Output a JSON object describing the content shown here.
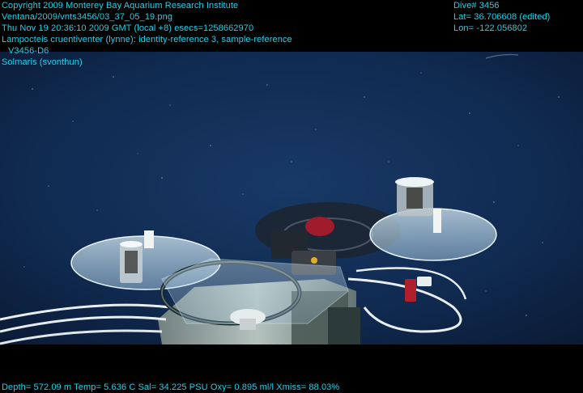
{
  "overlay": {
    "copyright": "Copyright 2009 Monterey Bay Aquarium Research Institute",
    "file_path": "Ventana/2009/vnts3456/03_37_05_19.png",
    "timestamp": "Thu Nov 19 20:36:10 2009 GMT (local +8)  esecs=1258662970",
    "annotation": "Lampocteis cruentiventer (lynne): identity-reference 3, sample-reference",
    "sample_id": "V3456-D6",
    "sampler": "Solmaris (svonthun)",
    "dive": "Dive# 3456",
    "lat": "Lat= 36.706608 (edited)",
    "lon": "Lon= -122.056802",
    "sensors": "Depth= 572.09 m  Temp= 5.636 C  Sal= 34.225 PSU  Oxy= 0.895 ml/l  Xmiss= 88.03%"
  },
  "colors": {
    "overlay_text": "#19d3ee",
    "water_deep": "#0a1a34",
    "water_mid": "#14305a",
    "letterbox": "#000000"
  }
}
